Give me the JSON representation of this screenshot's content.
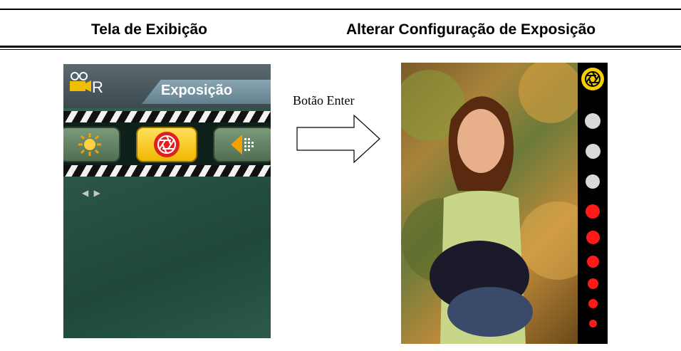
{
  "header": {
    "col_left": "Tela de Exibição",
    "col_right": "Alterar Configuração de Exposição"
  },
  "left_screen": {
    "mode": "R",
    "tab_label": "Exposição",
    "icons": [
      "sun-icon",
      "exposure-aperture-icon",
      "sharpness-icon"
    ],
    "selected_index": 1,
    "nav_arrows": "◀ ▶"
  },
  "middle": {
    "label": "Botão Enter"
  },
  "right_screen": {
    "level_icon": "exposure-aperture-icon",
    "dot_colors": [
      "#d9d9d9",
      "#d9d9d9",
      "#d9d9d9",
      "#ff1a1a",
      "#ff1a1a",
      "#ff1a1a",
      "#ff1a1a",
      "#ff1a1a",
      "#ff1a1a"
    ]
  },
  "colors": {
    "accent_yellow": "#f0b800",
    "indicator_red": "#ff1a1a",
    "indicator_gray": "#d9d9d9"
  }
}
